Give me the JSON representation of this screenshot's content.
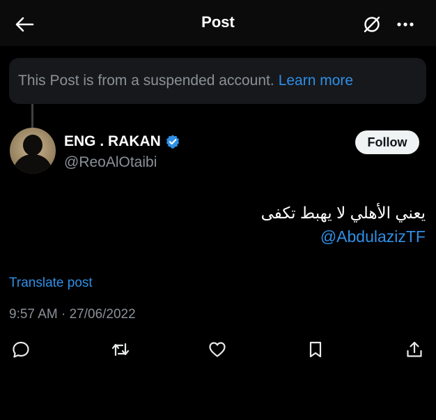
{
  "header": {
    "title": "Post",
    "back_icon": "arrow-left-icon",
    "nosign_icon": "no-sign-icon",
    "more_icon": "more-horizontal-icon"
  },
  "notice": {
    "text": "This Post is from a suspended account.",
    "link_text": "Learn more"
  },
  "author": {
    "display_name": "ENG . RAKAN",
    "handle": "@ReoAlOtaibi",
    "verified": true,
    "follow_label": "Follow"
  },
  "tweet": {
    "text": "يعني الأهلي لا يهبط تكفى",
    "mention": "@AbdulazizTF",
    "translate_label": "Translate post",
    "timestamp": "9:57 AM · 27/06/2022"
  },
  "actions": [
    "reply-icon",
    "retweet-icon",
    "like-icon",
    "bookmark-icon",
    "share-icon"
  ],
  "colors": {
    "accent": "#2f8fe6",
    "background": "#000000",
    "muted": "#8b9197",
    "notice_bg": "#16181c"
  }
}
